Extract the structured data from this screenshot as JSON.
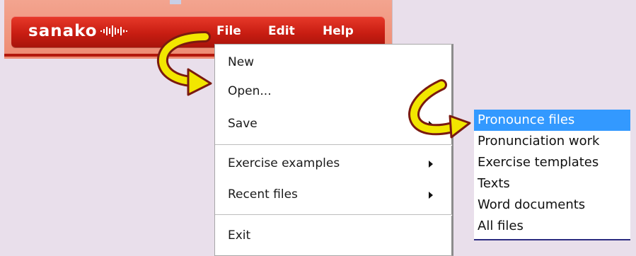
{
  "app": {
    "logo_text": "sanako",
    "menu": {
      "file": "File",
      "edit": "Edit",
      "help": "Help"
    }
  },
  "file_menu": {
    "items": [
      {
        "label": "New",
        "has_submenu": false
      },
      {
        "label": "Open...",
        "has_submenu": false
      },
      {
        "label": "Save",
        "has_submenu": true
      },
      {
        "label": "Exercise examples",
        "has_submenu": true
      },
      {
        "label": "Recent files",
        "has_submenu": true
      },
      {
        "label": "Exit",
        "has_submenu": false
      }
    ]
  },
  "save_submenu": {
    "selected_index": 0,
    "items": [
      {
        "label": "Pronounce files"
      },
      {
        "label": "Pronunciation work"
      },
      {
        "label": "Exercise templates"
      },
      {
        "label": "Texts"
      },
      {
        "label": "Word documents"
      },
      {
        "label": "All files"
      }
    ]
  },
  "colors": {
    "toolbar_red": "#c81d12",
    "page_background": "#e9dfeb",
    "selection_blue": "#3399ff",
    "callout_arrow_fill": "#f2e600",
    "callout_arrow_outline": "#7a1a10"
  },
  "icons": {
    "logo_wave": "audio-wave-icon",
    "callout_arrow_1": "curved-arrow-icon",
    "callout_arrow_2": "curved-arrow-icon",
    "submenu_arrow": "chevron-right-icon"
  }
}
